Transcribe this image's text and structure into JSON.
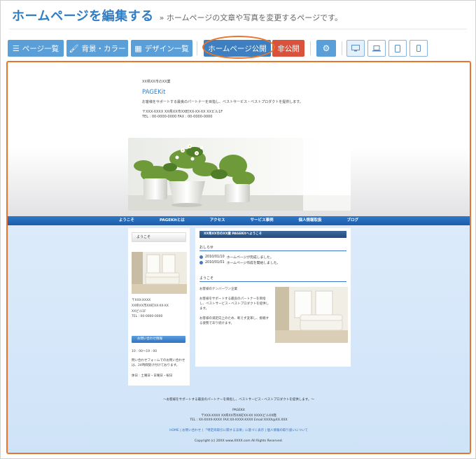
{
  "header": {
    "title": "ホームページを編集する",
    "subtitle": "» ホームページの文章や写真を変更するページです。"
  },
  "toolbar": {
    "page_list": "ページ一覧",
    "background_color": "背景・カラー",
    "design_list": "デザイン一覧",
    "publish": "ホームページ公開",
    "unpublish": "非公開",
    "icons": {
      "page_list": "list-icon",
      "background_color": "brush-icon",
      "design_list": "grid-icon",
      "settings": "gear-icon",
      "devices": [
        "desktop-icon",
        "laptop-icon",
        "tablet-icon",
        "mobile-icon"
      ]
    },
    "colors": {
      "button": "#5a9fd8",
      "publish": "#3e7fc1",
      "unpublish": "#d9523c",
      "highlight": "#e8752a"
    }
  },
  "preview": {
    "site": {
      "tagline": "XX県XX市のXX業",
      "name": "PAGEKit",
      "description": "お客様をサポートする最良のパートナーを目指し、ベストサービス・ベストプロダクトを提供します。",
      "address": "〒XXX-XXXX  XX県XX市XX町XX-XX-XX  XXビル1F",
      "tel_fax": "TEL : 00-0000-0000  FAX : 00-0000-0000"
    },
    "nav": [
      "ようこそ",
      "PAGEKitとは",
      "アクセス",
      "サービス事例",
      "個人情報取扱",
      "ブログ"
    ],
    "sidebar": {
      "heading": "ようこそ",
      "address_lines": [
        "〒XXX-XXXX",
        "XX県XX市XX町XX-XX-XX",
        "XXビル1F",
        "TEL : 00-0000-0000"
      ],
      "contact_label": "お問い合わせ情報",
      "hours": "10 : 00〜19 : 00",
      "contact_note_lines": [
        "問い合わせフォームでのお問い合わせ",
        "は、24時間受け付けております。"
      ],
      "holiday": "休日 : 土曜日・日曜日・祝日"
    },
    "main": {
      "header": "XX県XX市のXX業 PAGEKitへようこそ",
      "news_title": "おしらせ",
      "news": [
        {
          "date": "2010/01/10",
          "text": "ホームページが完成しました。"
        },
        {
          "date": "2010/01/01",
          "text": "ホームページ作成を開始しました。"
        }
      ],
      "welcome_title": "ようこそ",
      "welcome_sub": "お客様のナンバーワン企業",
      "welcome_lines": [
        "お客様をサポートする最良のパートナーを目指",
        "し、ベストサービス・ベストプロダクトを提供し",
        "ます。"
      ],
      "welcome_lines2": [
        "お客様の満足向上のため、断えず変革し、挑戦す",
        "る姿勢であり続けます。"
      ]
    },
    "footer": {
      "tagline": "〜お客様をサポートする最良のパートナーを目指し、ベストサービス・ベストプロダクトを提供します。〜",
      "name": "PAGEKit",
      "address": "〒XXX-XXXX  XX県XX市XX町XX-XX  XXXXビルXX階",
      "contact": "TEL : XX-XXXX-XXXX  FAX:XX-XXXX-XXXX  Email:XXXX@XX.XXX",
      "links": "HOME | お問い合わせ | 「特定商取引に関する法律」に基づく表示 | 個人情報の取り扱いについて",
      "copyright": "Copyright (c) 20XX www.XXXX.com All Rights Reserved."
    }
  }
}
